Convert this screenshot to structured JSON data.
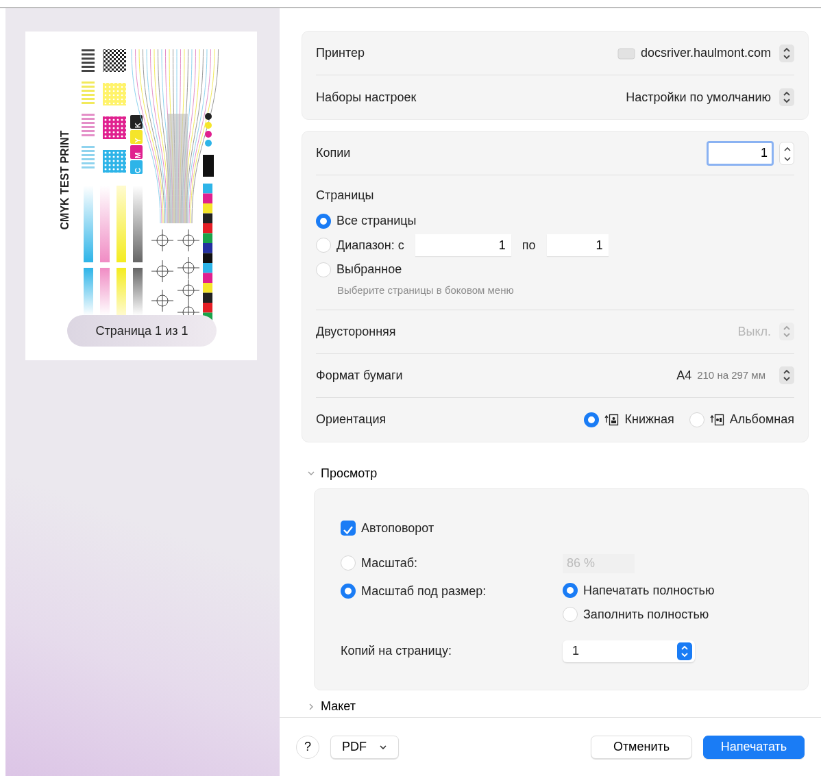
{
  "preview": {
    "document_title": "CMYK TEST PRINT",
    "ink_labels": [
      "C",
      "M",
      "Y",
      "K"
    ],
    "page_indicator": "Страница 1 из 1"
  },
  "presets_card": [
    {
      "kind": "printer",
      "label": "Принтер",
      "value": "docsriver.haulmont.com"
    },
    {
      "kind": "popup",
      "label": "Наборы настроек",
      "value": "Настройки по умолчанию"
    }
  ],
  "copies": {
    "label": "Копии",
    "value": "1"
  },
  "pages": {
    "label": "Страницы",
    "options": [
      {
        "kind": "plain",
        "label": "Все страницы",
        "selected": true
      },
      {
        "kind": "range",
        "label": "Диапазон: с",
        "selected": false,
        "from": "1",
        "to_label": "по",
        "to": "1"
      },
      {
        "kind": "hint",
        "label": "Выбранное",
        "selected": false,
        "hint": "Выберите страницы в боковом меню"
      }
    ]
  },
  "duplex": {
    "label": "Двусторонняя",
    "value": "Выкл.",
    "disabled": true
  },
  "paper": {
    "label": "Формат бумаги",
    "value": "A4",
    "detail": "210 на 297 мм"
  },
  "orientation": {
    "label": "Ориентация",
    "options": [
      {
        "kind": "portrait",
        "label": "Книжная",
        "selected": true
      },
      {
        "kind": "landscape",
        "label": "Альбомная",
        "selected": false
      }
    ]
  },
  "preview_section": {
    "title": "Просмотр",
    "expanded": true,
    "auto_rotate": {
      "label": "Автоповорот",
      "checked": true
    },
    "scale": {
      "label": "Масштаб:",
      "selected": false,
      "value": "86 %",
      "disabled": true
    },
    "fit": {
      "label": "Масштаб под размер:",
      "selected": true,
      "options": [
        {
          "label": "Напечатать полностью",
          "selected": true
        },
        {
          "label": "Заполнить полностью",
          "selected": false
        }
      ]
    },
    "copies_per_page": {
      "label": "Копий на страницу:",
      "value": "1"
    }
  },
  "layout_section": {
    "title": "Макет",
    "expanded": false
  },
  "footer": {
    "help": "?",
    "pdf": "PDF",
    "cancel": "Отменить",
    "print": "Напечатать"
  }
}
